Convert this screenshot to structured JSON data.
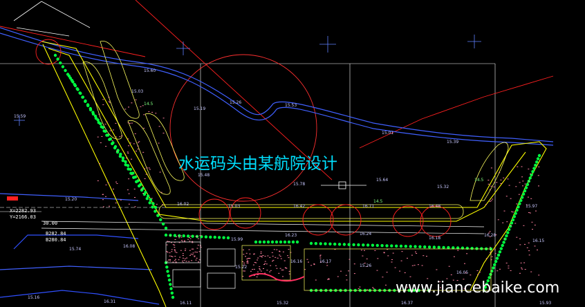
{
  "title_text": "水运码头由某航院设计",
  "watermark": "www.jiancebaike.com",
  "left_labels": {
    "coord_x": "X=2282.93",
    "coord_y": "Y=2166.03",
    "elev_b1": "B282.84",
    "elev_b2": "B280.84",
    "elev_c": "30.00"
  },
  "green_elevations": [
    "14.5",
    "14.5",
    "14.5"
  ],
  "elevation_labels": [
    "15.59",
    "15.03",
    "15.60",
    "15.19",
    "15.26",
    "15.53",
    "15.01",
    "15.39",
    "15.48",
    "15.78",
    "15.64",
    "15.32",
    "15.20",
    "15.74",
    "16.08",
    "16.02",
    "15.03",
    "16.42",
    "16.71",
    "16.48",
    "15.97",
    "15.99",
    "16.23",
    "16.24",
    "16.18",
    "16.28",
    "16.15",
    "16.16",
    "15.26",
    "16.05",
    "15.16",
    "16.31",
    "15.32",
    "16.11",
    "16.37",
    "15.93",
    "15.22",
    "16.17"
  ],
  "colors": {
    "background": "#000000",
    "boundary": "#ffff00",
    "trees": "#00ff40",
    "road": "#3050ff",
    "circles": "#ff3030",
    "title": "#00e0ff",
    "grid": "#ffffff"
  }
}
